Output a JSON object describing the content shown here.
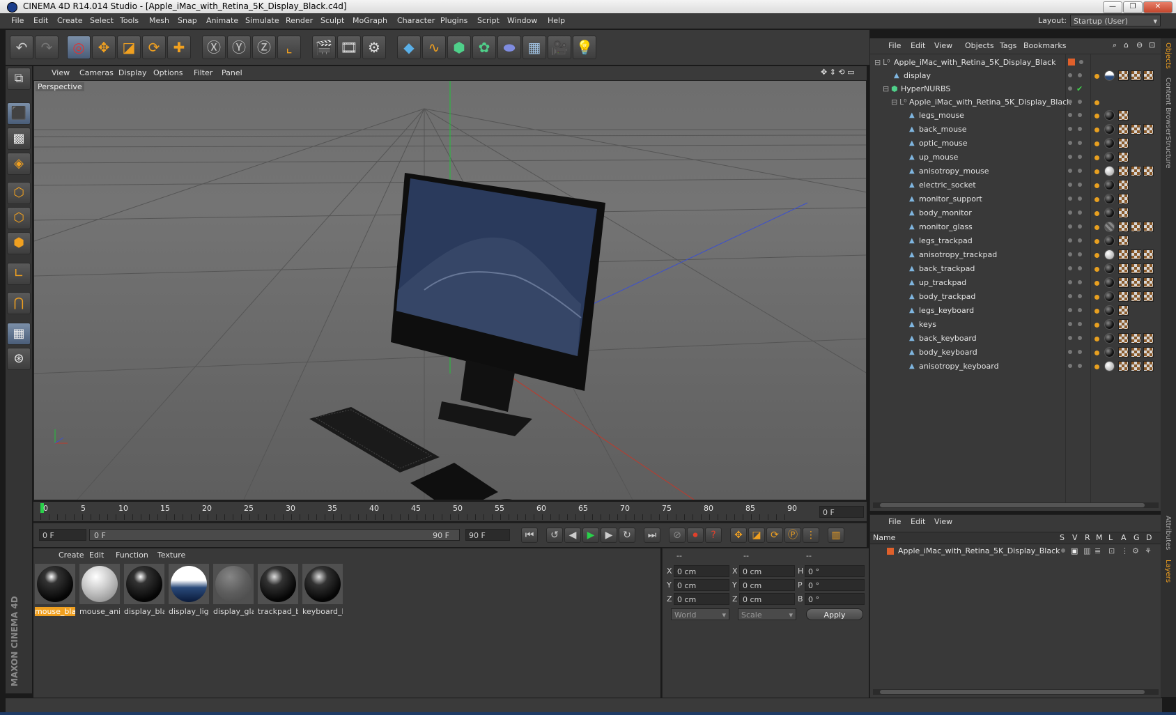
{
  "window": {
    "title": "CINEMA 4D R14.014 Studio - [Apple_iMac_with_Retina_5K_Display_Black.c4d]",
    "min": "—",
    "max": "❐",
    "close": "✕"
  },
  "menu": [
    "File",
    "Edit",
    "Create",
    "Select",
    "Tools",
    "Mesh",
    "Snap",
    "Animate",
    "Simulate",
    "Render",
    "Sculpt",
    "MoGraph",
    "Character",
    "Plugins",
    "Script",
    "Window",
    "Help"
  ],
  "layout": {
    "label": "Layout:",
    "value": "Startup (User)"
  },
  "viewport": {
    "menu": [
      "View",
      "Cameras",
      "Display",
      "Options",
      "Filter",
      "Panel"
    ],
    "label": "Perspective"
  },
  "timeline": {
    "ticks": [
      "0",
      "5",
      "10",
      "15",
      "20",
      "25",
      "30",
      "35",
      "40",
      "45",
      "50",
      "55",
      "60",
      "65",
      "70",
      "75",
      "80",
      "85",
      "90"
    ],
    "current": "0 F",
    "start": "0 F",
    "range_start": "0 F",
    "range_end": "90 F",
    "end": "90 F"
  },
  "materials": {
    "menu": [
      "Create",
      "Edit",
      "Function",
      "Texture"
    ],
    "items": [
      "mouse_bla",
      "mouse_ani",
      "display_bla",
      "display_ligl",
      "display_gla",
      "trackpad_b",
      "keyboard_l"
    ]
  },
  "coords": {
    "headers": [
      "--",
      "--",
      "--"
    ],
    "x": "X",
    "y": "Y",
    "z": "Z",
    "h": "H",
    "p": "P",
    "b": "B",
    "pos": "0 cm",
    "rot": "0 °",
    "world": "World",
    "scale": "Scale",
    "apply": "Apply"
  },
  "objects": {
    "menu": [
      "File",
      "Edit",
      "View",
      "Objects",
      "Tags",
      "Bookmarks"
    ],
    "root": "Apple_iMac_with_Retina_5K_Display_Black",
    "display": "display",
    "hypernurbs": "HyperNURBS",
    "group": "Apple_iMac_with_Retina_5K_Display_Black",
    "children": [
      "legs_mouse",
      "back_mouse",
      "optic_mouse",
      "up_mouse",
      "anisotropy_mouse",
      "electric_socket",
      "monitor_support",
      "body_monitor",
      "monitor_glass",
      "legs_trackpad",
      "anisotropy_trackpad",
      "back_trackpad",
      "up_trackpad",
      "body_trackpad",
      "legs_keyboard",
      "keys",
      "back_keyboard",
      "body_keyboard",
      "anisotropy_keyboard"
    ]
  },
  "layers": {
    "menu": [
      "File",
      "Edit",
      "View"
    ],
    "columns": [
      "Name",
      "S",
      "V",
      "R",
      "M",
      "L",
      "A",
      "G",
      "D"
    ],
    "row": "Apple_iMac_with_Retina_5K_Display_Black"
  },
  "side_tabs": [
    "Objects",
    "Content Browser",
    "Structure",
    "Attributes",
    "Layers"
  ],
  "brand": "MAXON CINEMA 4D",
  "colors": {
    "accent": "#f0a020",
    "selected_material": "#f0a020",
    "bg": "#393939"
  }
}
